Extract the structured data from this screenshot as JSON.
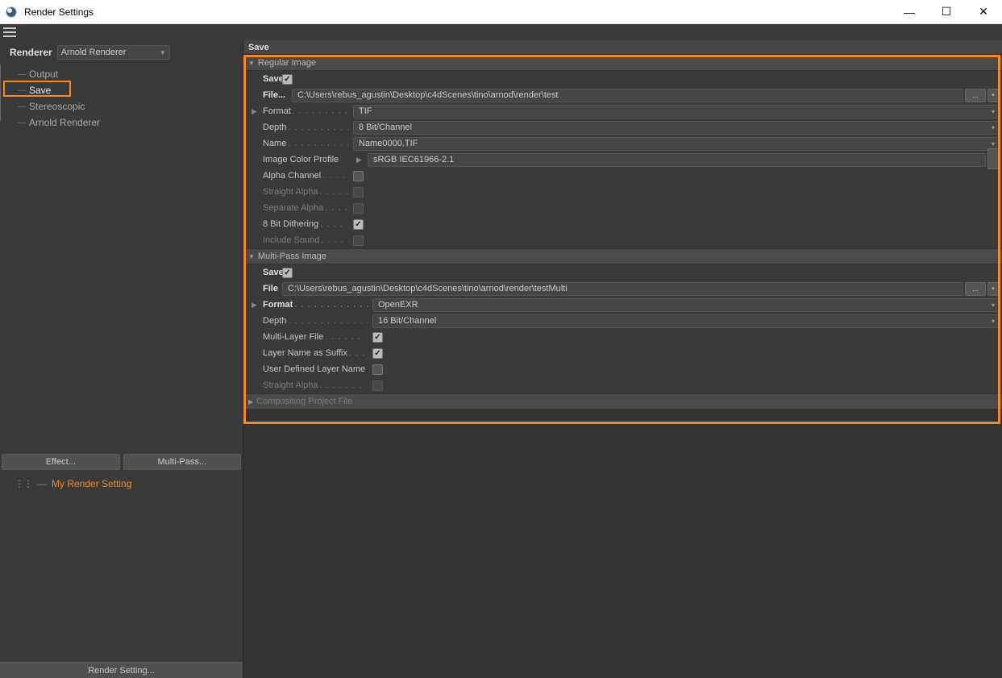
{
  "window": {
    "title": "Render Settings"
  },
  "left": {
    "renderer_label": "Renderer",
    "renderer_value": "Arnold Renderer",
    "tree": {
      "output": "Output",
      "save": "Save",
      "stereoscopic": "Stereoscopic",
      "arnold": "Arnold Renderer"
    },
    "effect_btn": "Effect...",
    "multipass_btn": "Multi-Pass...",
    "my_render": "My Render Setting",
    "render_setting_btn": "Render Setting..."
  },
  "main": {
    "header": "Save",
    "regular": {
      "title": "Regular Image",
      "save_lbl": "Save",
      "file_lbl": "File...",
      "file_val": "C:\\Users\\rebus_agustin\\Desktop\\c4dScenes\\tino\\arnod\\render\\test",
      "format_lbl": "Format",
      "format_val": "TIF",
      "depth_lbl": "Depth",
      "depth_val": "8 Bit/Channel",
      "name_lbl": "Name",
      "name_val": "Name0000.TIF",
      "profile_lbl": "Image Color Profile",
      "profile_val": "sRGB IEC61966-2.1",
      "alpha_lbl": "Alpha Channel",
      "straight_lbl": "Straight Alpha",
      "separate_lbl": "Separate Alpha",
      "dither_lbl": "8 Bit Dithering",
      "sound_lbl": "Include Sound"
    },
    "multipass": {
      "title": "Multi-Pass Image",
      "save_lbl": "Save",
      "file_lbl": "File",
      "file_val": "C:\\Users\\rebus_agustin\\Desktop\\c4dScenes\\tino\\arnod\\render\\testMulti",
      "format_lbl": "Format",
      "format_val": "OpenEXR",
      "depth_lbl": "Depth",
      "depth_val": "16 Bit/Channel",
      "multilayer_lbl": "Multi-Layer File",
      "layername_lbl": "Layer Name as Suffix",
      "userlayer_lbl": "User Defined Layer Name",
      "straight_lbl": "Straight Alpha"
    },
    "compositing": {
      "title": "Compositing Project File"
    }
  }
}
